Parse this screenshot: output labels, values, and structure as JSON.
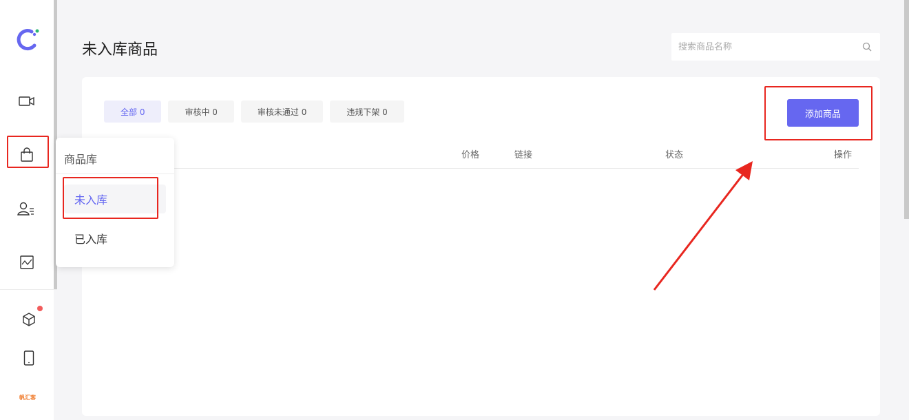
{
  "app": {
    "title": "未入库商品",
    "brand_text": "帆汇客"
  },
  "search": {
    "placeholder": "搜索商品名称",
    "value": ""
  },
  "tabs": [
    {
      "label": "全部 0",
      "active": true
    },
    {
      "label": "审核中 0",
      "active": false
    },
    {
      "label": "审核未通过 0",
      "active": false
    },
    {
      "label": "违规下架 0",
      "active": false
    }
  ],
  "toolbar": {
    "add_label": "添加商品"
  },
  "table": {
    "columns": [
      "价格",
      "链接",
      "状态",
      "操作"
    ]
  },
  "dropdown": {
    "title": "商品库",
    "items": [
      "未入库",
      "已入库"
    ]
  },
  "sidebar": {
    "icons": [
      "logo-icon",
      "video-icon",
      "shopping-bag-icon",
      "user-list-icon",
      "chart-icon",
      "cube-icon",
      "phone-icon"
    ]
  },
  "colors": {
    "accent": "#6667f0",
    "highlight": "#e8261f",
    "badge": "#f25c5c"
  }
}
